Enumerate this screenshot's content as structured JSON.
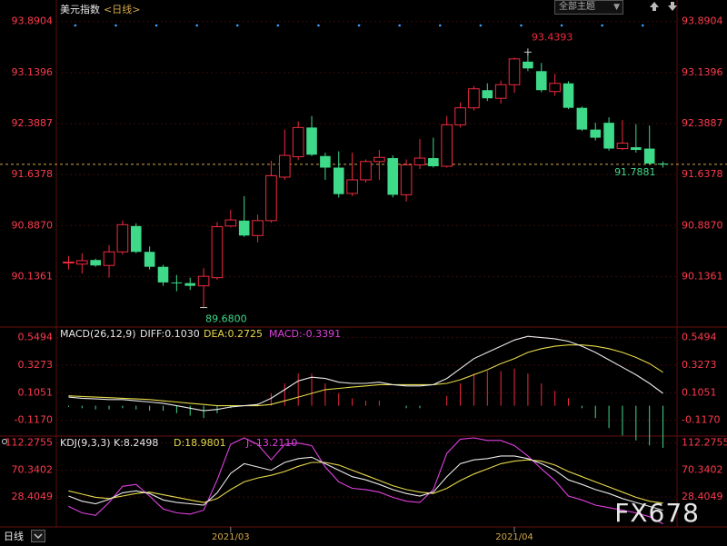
{
  "header": {
    "title": "美元指数",
    "period_label": "<日线>",
    "theme_dropdown": "全部主题",
    "theme_dropdown_icon": "triangle-down-icon",
    "nav_up_icon": "arrow-up-icon",
    "nav_down_icon": "arrow-down-icon"
  },
  "footer": {
    "period_tab": "日线",
    "period_tab_icon": "chevron-down-icon",
    "brand": "FX678"
  },
  "colors": {
    "up": "#ef2b3f",
    "down": "#3fd98a",
    "dif": "#e8e8e8",
    "dea": "#e6d84a",
    "k": "#e8e8e8",
    "d": "#e6d84a",
    "j": "#e040e0",
    "axis_label": "#ff3b4e",
    "grid": "#3a0a0a",
    "dotted_marks": "#3aa0ff"
  },
  "chart_data": [
    {
      "type": "candlestick",
      "title": "美元指数",
      "period": "日线",
      "y_ticks": [
        "93.8904",
        "93.1396",
        "92.3887",
        "91.6378",
        "90.8870",
        "90.1361"
      ],
      "ylim": [
        89.42,
        94.1
      ],
      "x_ticks": [
        "2021/03",
        "2021/04"
      ],
      "high_label": "93.4393",
      "low_label": "89.6800",
      "last_label": "91.7881",
      "last_value": 91.7881,
      "candles": [
        {
          "o": 90.35,
          "h": 90.44,
          "l": 90.24,
          "c": 90.35
        },
        {
          "o": 90.32,
          "h": 90.48,
          "l": 90.18,
          "c": 90.37
        },
        {
          "o": 90.38,
          "h": 90.4,
          "l": 90.28,
          "c": 90.3
        },
        {
          "o": 90.3,
          "h": 90.6,
          "l": 90.12,
          "c": 90.5
        },
        {
          "o": 90.5,
          "h": 90.96,
          "l": 90.46,
          "c": 90.9
        },
        {
          "o": 90.88,
          "h": 90.92,
          "l": 90.48,
          "c": 90.5
        },
        {
          "o": 90.5,
          "h": 90.58,
          "l": 90.24,
          "c": 90.28
        },
        {
          "o": 90.28,
          "h": 90.31,
          "l": 90.0,
          "c": 90.05
        },
        {
          "o": 90.05,
          "h": 90.16,
          "l": 89.92,
          "c": 90.04
        },
        {
          "o": 90.04,
          "h": 90.12,
          "l": 89.94,
          "c": 90.0
        },
        {
          "o": 90.0,
          "h": 90.26,
          "l": 89.68,
          "c": 90.14
        },
        {
          "o": 90.12,
          "h": 90.94,
          "l": 90.09,
          "c": 90.87
        },
        {
          "o": 90.88,
          "h": 91.12,
          "l": 90.86,
          "c": 90.97
        },
        {
          "o": 90.96,
          "h": 91.32,
          "l": 90.72,
          "c": 90.74
        },
        {
          "o": 90.74,
          "h": 91.05,
          "l": 90.64,
          "c": 90.96
        },
        {
          "o": 90.96,
          "h": 91.84,
          "l": 90.93,
          "c": 91.62
        },
        {
          "o": 91.6,
          "h": 92.3,
          "l": 91.56,
          "c": 91.92
        },
        {
          "o": 91.9,
          "h": 92.42,
          "l": 91.85,
          "c": 92.33
        },
        {
          "o": 92.33,
          "h": 92.5,
          "l": 91.91,
          "c": 91.93
        },
        {
          "o": 91.91,
          "h": 91.96,
          "l": 91.56,
          "c": 91.74
        },
        {
          "o": 91.74,
          "h": 91.98,
          "l": 91.3,
          "c": 91.35
        },
        {
          "o": 91.36,
          "h": 91.96,
          "l": 91.32,
          "c": 91.56
        },
        {
          "o": 91.56,
          "h": 91.86,
          "l": 91.52,
          "c": 91.83
        },
        {
          "o": 91.83,
          "h": 92.0,
          "l": 91.56,
          "c": 91.89
        },
        {
          "o": 91.88,
          "h": 91.92,
          "l": 91.3,
          "c": 91.34
        },
        {
          "o": 91.34,
          "h": 91.86,
          "l": 91.24,
          "c": 91.78
        },
        {
          "o": 91.78,
          "h": 92.16,
          "l": 91.72,
          "c": 91.88
        },
        {
          "o": 91.88,
          "h": 92.18,
          "l": 91.74,
          "c": 91.76
        },
        {
          "o": 91.76,
          "h": 92.5,
          "l": 91.74,
          "c": 92.37
        },
        {
          "o": 92.37,
          "h": 92.7,
          "l": 92.33,
          "c": 92.62
        },
        {
          "o": 92.62,
          "h": 92.94,
          "l": 92.58,
          "c": 92.9
        },
        {
          "o": 92.88,
          "h": 92.98,
          "l": 92.72,
          "c": 92.76
        },
        {
          "o": 92.76,
          "h": 93.02,
          "l": 92.68,
          "c": 92.96
        },
        {
          "o": 92.96,
          "h": 93.36,
          "l": 92.84,
          "c": 93.34
        },
        {
          "o": 93.3,
          "h": 93.44,
          "l": 93.16,
          "c": 93.2
        },
        {
          "o": 93.16,
          "h": 93.28,
          "l": 92.85,
          "c": 92.88
        },
        {
          "o": 92.86,
          "h": 93.12,
          "l": 92.8,
          "c": 92.98
        },
        {
          "o": 92.98,
          "h": 93.01,
          "l": 92.6,
          "c": 92.62
        },
        {
          "o": 92.62,
          "h": 92.64,
          "l": 92.28,
          "c": 92.3
        },
        {
          "o": 92.3,
          "h": 92.4,
          "l": 92.14,
          "c": 92.18
        },
        {
          "o": 92.4,
          "h": 92.48,
          "l": 91.99,
          "c": 92.02
        },
        {
          "o": 92.02,
          "h": 92.44,
          "l": 92.0,
          "c": 92.1
        },
        {
          "o": 92.04,
          "h": 92.38,
          "l": 91.96,
          "c": 92.0
        },
        {
          "o": 92.02,
          "h": 92.36,
          "l": 91.78,
          "c": 91.8
        },
        {
          "o": 91.8,
          "h": 91.83,
          "l": 91.74,
          "c": 91.79
        }
      ]
    },
    {
      "type": "bar+line",
      "title": "MACD(26,12,9)",
      "legend": [
        {
          "label": "DIFF:0.1030",
          "series": "DIFF"
        },
        {
          "label": "DEA:0.2725",
          "series": "DEA"
        },
        {
          "label": "MACD:-0.3391",
          "series": "MACD"
        }
      ],
      "y_ticks": [
        "0.5494",
        "0.3273",
        "0.1051",
        "-0.1170"
      ],
      "ylim": [
        -0.23,
        0.62
      ],
      "dif": [
        0.07,
        0.06,
        0.055,
        0.05,
        0.05,
        0.04,
        0.03,
        0.02,
        0.0,
        -0.02,
        -0.04,
        -0.03,
        -0.01,
        0.0,
        0.01,
        0.06,
        0.13,
        0.2,
        0.23,
        0.22,
        0.19,
        0.18,
        0.18,
        0.19,
        0.17,
        0.16,
        0.16,
        0.17,
        0.22,
        0.3,
        0.38,
        0.43,
        0.48,
        0.53,
        0.56,
        0.55,
        0.54,
        0.52,
        0.48,
        0.43,
        0.37,
        0.31,
        0.25,
        0.18,
        0.1
      ],
      "dea": [
        0.08,
        0.075,
        0.07,
        0.065,
        0.06,
        0.055,
        0.05,
        0.04,
        0.03,
        0.02,
        0.01,
        0.0,
        0.0,
        0.0,
        0.0,
        0.01,
        0.04,
        0.07,
        0.1,
        0.13,
        0.14,
        0.15,
        0.16,
        0.17,
        0.17,
        0.17,
        0.17,
        0.17,
        0.18,
        0.21,
        0.25,
        0.29,
        0.34,
        0.38,
        0.43,
        0.46,
        0.48,
        0.49,
        0.49,
        0.48,
        0.46,
        0.43,
        0.39,
        0.34,
        0.27
      ],
      "macd": [
        -0.01,
        -0.02,
        -0.03,
        -0.03,
        -0.02,
        -0.03,
        -0.04,
        -0.04,
        -0.06,
        -0.08,
        -0.1,
        -0.06,
        -0.02,
        0.0,
        0.02,
        0.1,
        0.18,
        0.26,
        0.26,
        0.18,
        0.1,
        0.06,
        0.04,
        0.04,
        0.0,
        -0.02,
        -0.02,
        0.0,
        0.08,
        0.18,
        0.26,
        0.28,
        0.28,
        0.3,
        0.26,
        0.18,
        0.12,
        0.06,
        -0.02,
        -0.1,
        -0.18,
        -0.24,
        -0.28,
        -0.32,
        -0.34
      ]
    },
    {
      "type": "line",
      "title": "KDJ(9,3,3)",
      "legend": [
        {
          "label": "K:8.2498",
          "series": "K"
        },
        {
          "label": "D:18.9801",
          "series": "D"
        },
        {
          "label": "J:-13.2110",
          "series": "J"
        }
      ],
      "y_ticks": [
        "112.2755",
        "70.3402",
        "28.4049"
      ],
      "ylim": [
        -15,
        120
      ],
      "k": [
        30,
        22,
        18,
        25,
        35,
        38,
        34,
        24,
        20,
        18,
        16,
        35,
        65,
        80,
        75,
        70,
        82,
        88,
        90,
        80,
        70,
        60,
        55,
        48,
        40,
        34,
        30,
        36,
        60,
        80,
        86,
        88,
        92,
        92,
        88,
        80,
        70,
        55,
        48,
        40,
        34,
        26,
        20,
        14,
        8
      ],
      "d": [
        38,
        33,
        28,
        26,
        30,
        34,
        36,
        32,
        28,
        24,
        20,
        26,
        40,
        52,
        58,
        62,
        68,
        76,
        82,
        82,
        78,
        70,
        62,
        54,
        46,
        40,
        36,
        34,
        42,
        54,
        64,
        72,
        80,
        84,
        86,
        84,
        78,
        68,
        60,
        52,
        44,
        36,
        28,
        22,
        19
      ],
      "j": [
        14,
        4,
        0,
        20,
        45,
        48,
        30,
        10,
        4,
        2,
        8,
        55,
        110,
        120,
        110,
        86,
        110,
        112,
        108,
        75,
        52,
        42,
        40,
        36,
        28,
        22,
        20,
        40,
        96,
        118,
        120,
        116,
        116,
        108,
        92,
        72,
        54,
        30,
        24,
        16,
        12,
        8,
        4,
        -2,
        -13
      ]
    }
  ]
}
